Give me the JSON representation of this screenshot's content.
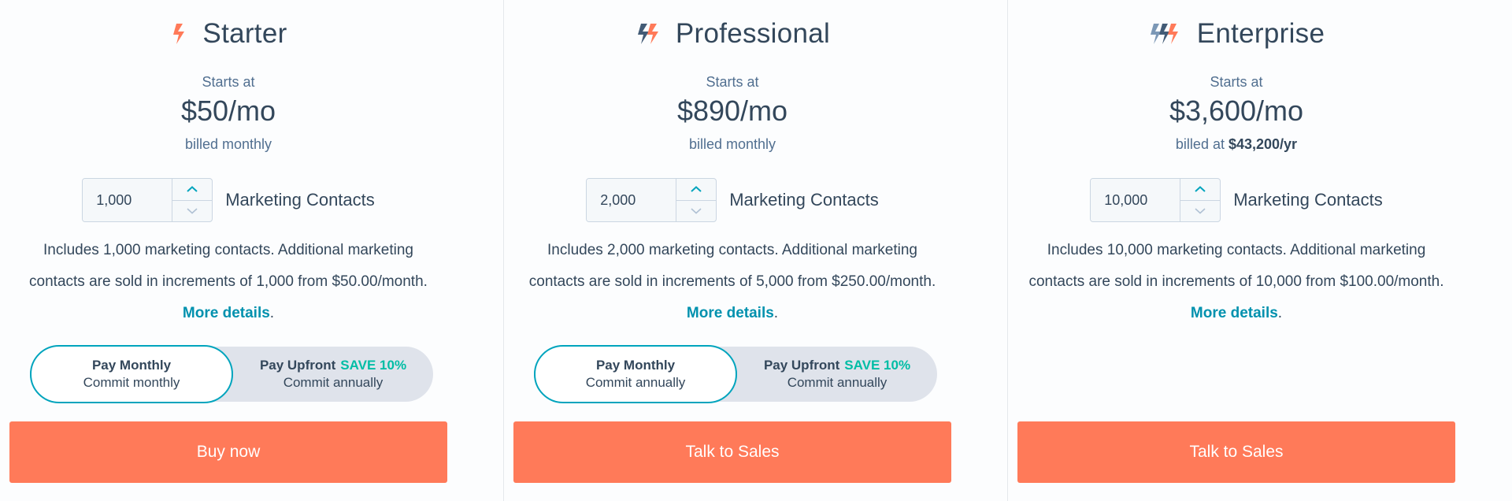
{
  "colors": {
    "accent": "#ff7a59",
    "link": "#0091ae",
    "save": "#00bda5",
    "text": "#33475b",
    "toggle_border": "#00a4bd"
  },
  "plans": [
    {
      "name": "Starter",
      "logo_icon": "sprocket-single-orange-icon",
      "starts_at": "Starts at",
      "price": "$50/mo",
      "billed_prefix": "billed monthly",
      "billed_amount": "",
      "contacts_value": "1,000",
      "contacts_label": "Marketing Contacts",
      "desc_text": "Includes 1,000 marketing contacts. Additional marketing contacts are sold in increments of 1,000 from $50.00/month.",
      "more_details": "More details",
      "desc_end": ".",
      "toggle": {
        "left_main": "Pay Monthly",
        "left_sub": "Commit monthly",
        "right_main": "Pay Upfront",
        "right_save": "SAVE 10%",
        "right_sub": "Commit annually",
        "selected": "left"
      },
      "cta": "Buy now"
    },
    {
      "name": "Professional",
      "logo_icon": "sprocket-double-icon",
      "starts_at": "Starts at",
      "price": "$890/mo",
      "billed_prefix": "billed monthly",
      "billed_amount": "",
      "contacts_value": "2,000",
      "contacts_label": "Marketing Contacts",
      "desc_text": "Includes 2,000 marketing contacts. Additional marketing contacts are sold in increments of 5,000 from $250.00/month.",
      "more_details": "More details",
      "desc_end": ".",
      "toggle": {
        "left_main": "Pay Monthly",
        "left_sub": "Commit annually",
        "right_main": "Pay Upfront",
        "right_save": "SAVE 10%",
        "right_sub": "Commit annually",
        "selected": "left"
      },
      "cta": "Talk to Sales"
    },
    {
      "name": "Enterprise",
      "logo_icon": "sprocket-triple-icon",
      "starts_at": "Starts at",
      "price": "$3,600/mo",
      "billed_prefix": "billed at ",
      "billed_amount": "$43,200/yr",
      "contacts_value": "10,000",
      "contacts_label": "Marketing Contacts",
      "desc_text": "Includes 10,000 marketing contacts. Additional marketing contacts are sold in increments of 10,000 from $100.00/month.",
      "more_details": "More details",
      "desc_end": ".",
      "cta": "Talk to Sales"
    }
  ]
}
